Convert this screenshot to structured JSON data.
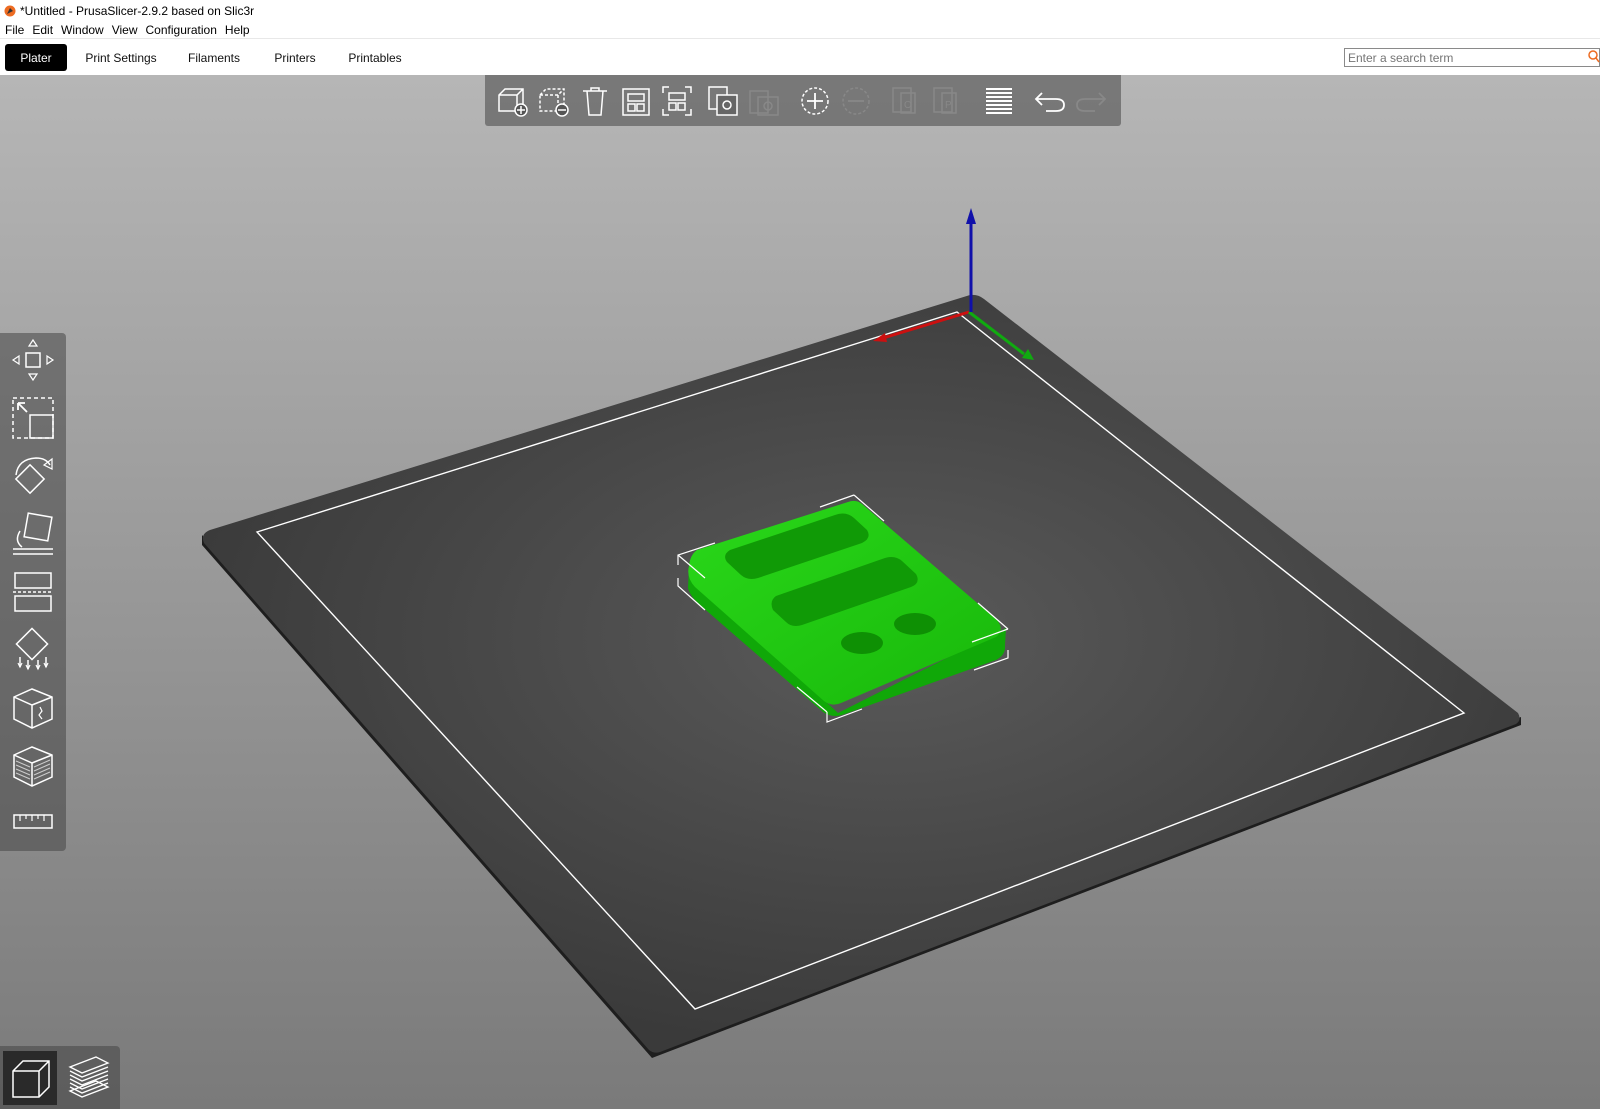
{
  "window": {
    "title": "*Untitled - PrusaSlicer-2.9.2 based on Slic3r"
  },
  "menu": {
    "items": [
      "File",
      "Edit",
      "Window",
      "View",
      "Configuration",
      "Help"
    ]
  },
  "tabs": [
    {
      "label": "Plater",
      "active": true
    },
    {
      "label": "Print Settings",
      "active": false
    },
    {
      "label": "Filaments",
      "active": false
    },
    {
      "label": "Printers",
      "active": false
    },
    {
      "label": "Printables",
      "active": false
    }
  ],
  "search": {
    "placeholder": "Enter a search term"
  },
  "top_toolbar": {
    "buttons": [
      "add-object-icon",
      "delete-icon",
      "delete-all-icon",
      "arrange-icon",
      "arrange-selection-icon",
      "copy-icon",
      "paste-icon",
      "add-instance-icon",
      "remove-instance-icon",
      "split-objects-icon",
      "split-parts-icon",
      "layers-editing-icon",
      "undo-icon",
      "redo-icon"
    ],
    "disabled": [
      "paste-icon",
      "remove-instance-icon",
      "split-objects-icon",
      "split-parts-icon",
      "redo-icon"
    ]
  },
  "left_toolbar": {
    "buttons": [
      "move-icon",
      "scale-icon",
      "rotate-icon",
      "place-on-face-icon",
      "cut-icon",
      "support-painting-icon",
      "seam-painting-icon",
      "mmu-painting-icon",
      "measure-icon"
    ]
  },
  "view_modes": [
    {
      "name": "3d-view-icon",
      "active": true
    },
    {
      "name": "preview-icon",
      "active": false
    }
  ],
  "colors": {
    "object": "#22cc10",
    "bed": "#3a3a3a",
    "axis_x": "#cc1010",
    "axis_y": "#10aa10",
    "axis_z": "#1010aa"
  }
}
